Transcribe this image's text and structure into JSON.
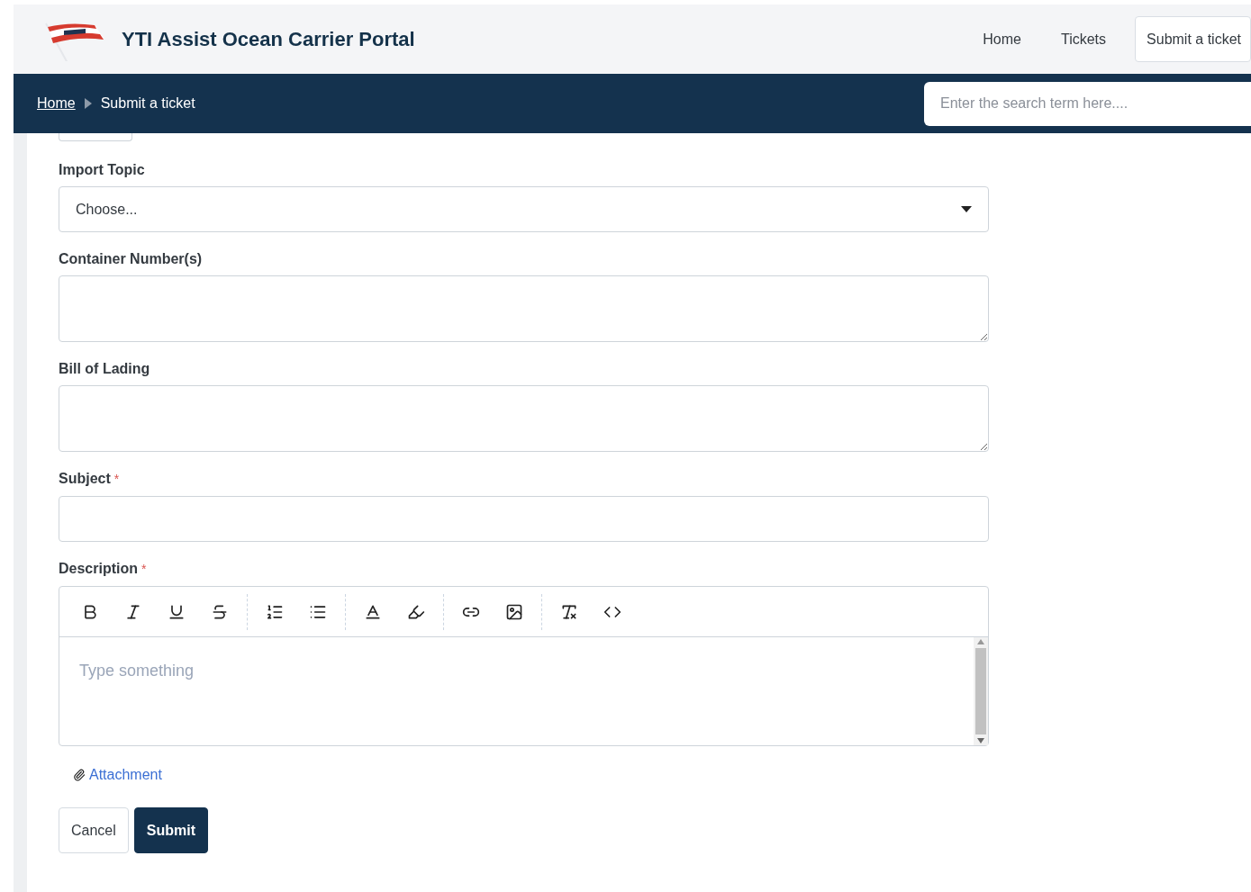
{
  "header": {
    "title": "YTI Assist Ocean Carrier Portal",
    "nav": [
      {
        "label": "Home",
        "selected": false
      },
      {
        "label": "Tickets",
        "selected": false
      },
      {
        "label": "Submit a ticket",
        "selected": true
      }
    ]
  },
  "breadcrumb": [
    {
      "kind": "link",
      "label": "Home"
    },
    {
      "kind": "current",
      "label": "Submit a ticket"
    }
  ],
  "search": {
    "placeholder": "Enter the search term here...."
  },
  "fields": [
    {
      "kind": "select",
      "label": "Import Topic",
      "value": "Choose..."
    },
    {
      "kind": "textarea",
      "label": "Container Number(s)"
    },
    {
      "kind": "textarea",
      "label": "Bill of Lading"
    },
    {
      "kind": "input",
      "label": "Subject",
      "marker": "*"
    },
    {
      "kind": "editor",
      "label": "Description",
      "marker": "*",
      "placeholder": "Type something"
    }
  ],
  "attachment": "Attachment",
  "buttons": [
    {
      "kind": "secondary",
      "label": "Cancel"
    },
    {
      "kind": "primary",
      "label": "Submit"
    }
  ]
}
